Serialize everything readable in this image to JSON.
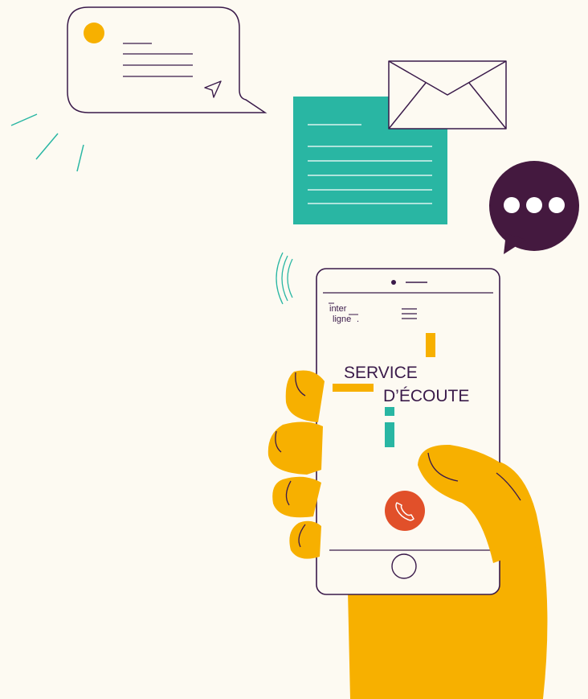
{
  "colors": {
    "background": "#fdfaf2",
    "ink": "#3a1a4a",
    "yellow": "#f7b000",
    "teal": "#29b6a3",
    "call_red": "#e1502a",
    "bubble_dark": "#44193f"
  },
  "phone": {
    "logo": {
      "line1": "inter",
      "line2": "ligne",
      "suffix": "."
    },
    "menu_icon": "hamburger-icon",
    "headline": {
      "line1": "SERVICE",
      "line2": "D’ÉCOUTE"
    },
    "call_button_icon": "phone-handset-icon",
    "home_button_icon": "home-button"
  },
  "chat_bubble": {
    "icon": "send-icon",
    "avatar": "avatar-dot"
  },
  "envelope": {
    "icon": "envelope-icon"
  },
  "speech_bubble": {
    "icon": "ellipsis-icon"
  }
}
